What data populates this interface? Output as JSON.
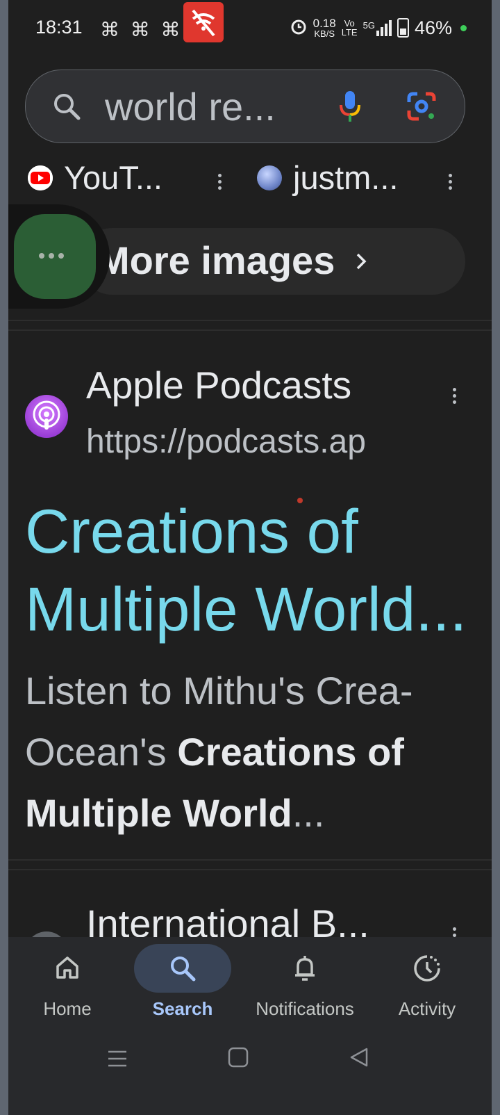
{
  "status_bar": {
    "time": "18:31",
    "notification_icons": "⌘ ⌘ ⌘",
    "net_speed_value": "0.18",
    "net_speed_unit": "KB/S",
    "volte_top": "Vo",
    "volte_bottom": "LTE",
    "network": "5G",
    "battery": "46%"
  },
  "search": {
    "query": "world re..."
  },
  "sources": [
    {
      "label": "YouT...",
      "icon": "youtube-icon"
    },
    {
      "label": "justm...",
      "icon": "globe-icon"
    }
  ],
  "more_images": {
    "label": "More images"
  },
  "result": {
    "site_name": "Apple Podcasts",
    "url": "https://podcasts.ap",
    "title_line1": "Creations of",
    "title_line2": "Multiple World...",
    "snippet_plain1": "Listen to Mithu's Crea-",
    "snippet_plain2": "Ocean's ",
    "snippet_bold2": "Creations of",
    "snippet_bold3": "Multiple World",
    "snippet_end3": "..."
  },
  "next_result": {
    "title": "International B..."
  },
  "bottom_nav": {
    "items": [
      {
        "label": "Home",
        "icon": "home-icon",
        "active": false
      },
      {
        "label": "Search",
        "icon": "search-icon",
        "active": true
      },
      {
        "label": "Notifications",
        "icon": "bell-icon",
        "active": false
      },
      {
        "label": "Activity",
        "icon": "activity-icon",
        "active": false
      }
    ]
  },
  "colors": {
    "background": "#1f1f1f",
    "link": "#78d9ec",
    "active_nav": "#a8c7fa"
  }
}
